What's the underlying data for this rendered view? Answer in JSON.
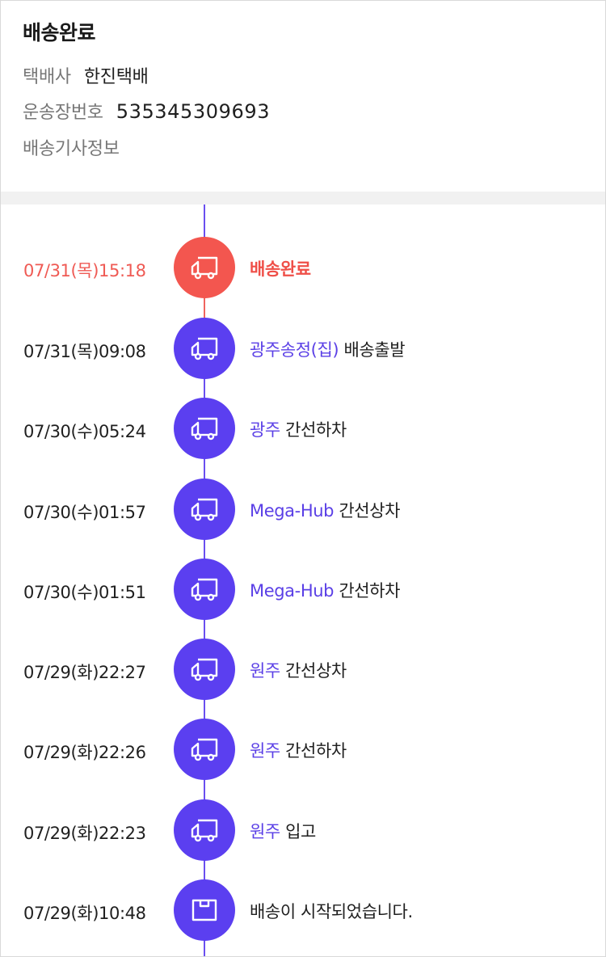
{
  "header": {
    "status_title": "배송완료",
    "courier_label": "택배사",
    "courier_value": "한진택배",
    "invoice_label": "운송장번호",
    "invoice_value": "535345309693",
    "driver_info_label": "배송기사정보"
  },
  "colors": {
    "accent_purple": "#5b3ff0",
    "accent_red": "#f3564f",
    "location_text": "#5a3fe6"
  },
  "timeline": {
    "events": [
      {
        "time": "07/31(목)15:18",
        "location": "",
        "action": "배송완료",
        "icon": "truck-icon",
        "state": "delivered"
      },
      {
        "time": "07/31(목)09:08",
        "location": "광주송정(집)",
        "action": " 배송출발",
        "icon": "truck-icon",
        "state": "transit"
      },
      {
        "time": "07/30(수)05:24",
        "location": "광주",
        "action": " 간선하차",
        "icon": "truck-icon",
        "state": "transit"
      },
      {
        "time": "07/30(수)01:57",
        "location": "Mega-Hub",
        "action": " 간선상차",
        "icon": "truck-icon",
        "state": "transit"
      },
      {
        "time": "07/30(수)01:51",
        "location": "Mega-Hub",
        "action": " 간선하차",
        "icon": "truck-icon",
        "state": "transit"
      },
      {
        "time": "07/29(화)22:27",
        "location": "원주",
        "action": " 간선상차",
        "icon": "truck-icon",
        "state": "transit"
      },
      {
        "time": "07/29(화)22:26",
        "location": "원주",
        "action": " 간선하차",
        "icon": "truck-icon",
        "state": "transit"
      },
      {
        "time": "07/29(화)22:23",
        "location": "원주",
        "action": " 입고",
        "icon": "truck-icon",
        "state": "transit"
      },
      {
        "time": "07/29(화)10:48",
        "location": "",
        "action": "배송이 시작되었습니다.",
        "icon": "box-icon",
        "state": "started"
      }
    ]
  }
}
